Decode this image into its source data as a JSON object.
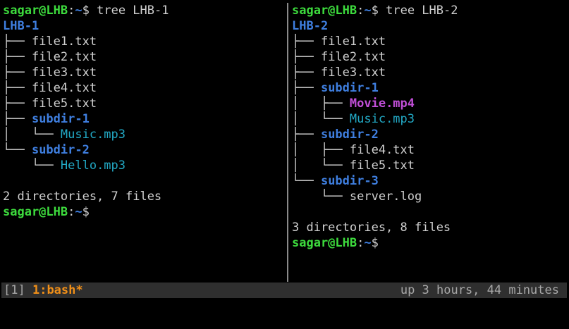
{
  "left_pane": {
    "prompt_user": "sagar@LHB",
    "prompt_colon": ":",
    "prompt_path": "~",
    "prompt_symbol": "$",
    "command": " tree LHB-1",
    "root": "LHB-1",
    "entries": [
      {
        "branch": "├── ",
        "name": "file1.txt"
      },
      {
        "branch": "├── ",
        "name": "file2.txt"
      },
      {
        "branch": "├── ",
        "name": "file3.txt"
      },
      {
        "branch": "├── ",
        "name": "file4.txt"
      },
      {
        "branch": "├── ",
        "name": "file5.txt"
      },
      {
        "branch": "├── ",
        "name": "subdir-1"
      },
      {
        "branch": "│   └── ",
        "name": "Music.mp3"
      },
      {
        "branch": "└── ",
        "name": "subdir-2"
      },
      {
        "branch": "    └── ",
        "name": "Hello.mp3"
      }
    ],
    "summary": "2 directories, 7 files",
    "final_prompt_user": "sagar@LHB",
    "final_prompt_colon": ":",
    "final_prompt_path": "~",
    "final_prompt_symbol": "$"
  },
  "right_pane": {
    "prompt_user": "sagar@LHB",
    "prompt_colon": ":",
    "prompt_path": "~",
    "prompt_symbol": "$",
    "command": " tree LHB-2",
    "root": "LHB-2",
    "entries": [
      {
        "branch": "├── ",
        "name": "file1.txt"
      },
      {
        "branch": "├── ",
        "name": "file2.txt"
      },
      {
        "branch": "├── ",
        "name": "file3.txt"
      },
      {
        "branch": "├── ",
        "name": "subdir-1"
      },
      {
        "branch": "│   ├── ",
        "name": "Movie.mp4"
      },
      {
        "branch": "│   └── ",
        "name": "Music.mp3"
      },
      {
        "branch": "├── ",
        "name": "subdir-2"
      },
      {
        "branch": "│   ├── ",
        "name": "file4.txt"
      },
      {
        "branch": "│   └── ",
        "name": "file5.txt"
      },
      {
        "branch": "└── ",
        "name": "subdir-3"
      },
      {
        "branch": "    └── ",
        "name": "server.log"
      }
    ],
    "summary": "3 directories, 8 files",
    "final_prompt_user": "sagar@LHB",
    "final_prompt_colon": ":",
    "final_prompt_path": "~",
    "final_prompt_symbol": "$"
  },
  "status_bar": {
    "session": "[1]",
    "window": "1:bash*",
    "uptime": "up 3 hours, 44 minutes"
  },
  "colors": {
    "background": "#000000",
    "prompt_user": "#3ddb3d",
    "prompt_path": "#3f7fe0",
    "directory": "#3f7fe0",
    "audio_file": "#22a9c5",
    "video_file": "#c14fd8",
    "status_bar_bg": "#2f2f2f",
    "active_window": "#f08f18"
  }
}
